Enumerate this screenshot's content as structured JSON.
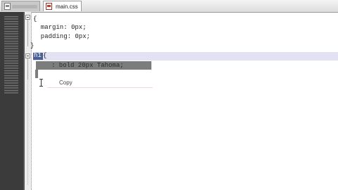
{
  "tabs": [
    {
      "label": "",
      "active": false
    },
    {
      "label": "main.css",
      "active": true
    }
  ],
  "code_lines": {
    "l1": "{",
    "l2": "  margin: 0px;",
    "l3": "  padding: 0px;",
    "l4": "}",
    "l5_selector": "h1",
    "l5_brace": "{",
    "l6_selected": ": bold 20px Tahoma;"
  },
  "context_menu": {
    "copy_label": "Copy"
  },
  "colors": {
    "selection": "#7c7c7c",
    "current_line": "#e2e2f4",
    "selector_highlight": "#4a5f95",
    "left_panel": "#3b3b3b"
  }
}
